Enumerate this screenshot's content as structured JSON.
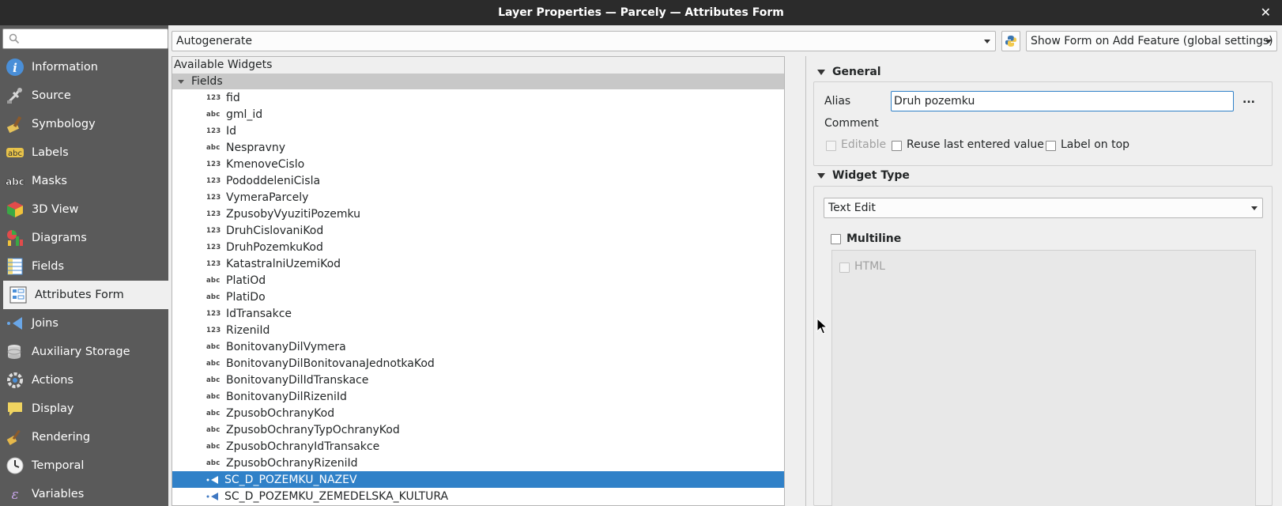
{
  "window": {
    "title": "Layer Properties — Parcely — Attributes Form",
    "close_glyph": "✕"
  },
  "sidebar": {
    "search_placeholder": "",
    "items": [
      {
        "label": "Information",
        "icon": "info-icon"
      },
      {
        "label": "Source",
        "icon": "source-icon"
      },
      {
        "label": "Symbology",
        "icon": "symbology-icon"
      },
      {
        "label": "Labels",
        "icon": "labels-icon"
      },
      {
        "label": "Masks",
        "icon": "masks-icon"
      },
      {
        "label": "3D View",
        "icon": "3d-view-icon"
      },
      {
        "label": "Diagrams",
        "icon": "diagrams-icon"
      },
      {
        "label": "Fields",
        "icon": "fields-icon"
      },
      {
        "label": "Attributes Form",
        "icon": "attributes-form-icon",
        "active": true
      },
      {
        "label": "Joins",
        "icon": "joins-icon"
      },
      {
        "label": "Auxiliary Storage",
        "icon": "auxiliary-storage-icon"
      },
      {
        "label": "Actions",
        "icon": "actions-icon"
      },
      {
        "label": "Display",
        "icon": "display-icon"
      },
      {
        "label": "Rendering",
        "icon": "rendering-icon"
      },
      {
        "label": "Temporal",
        "icon": "temporal-icon"
      },
      {
        "label": "Variables",
        "icon": "variables-icon"
      }
    ]
  },
  "toolbar": {
    "layout_mode": "Autogenerate",
    "python_icon": "python-icon",
    "form_mode": "Show Form on Add Feature (global settings)"
  },
  "widgets": {
    "header": "Available Widgets",
    "root": "Fields",
    "fields": [
      {
        "type": "123",
        "name": "fid"
      },
      {
        "type": "abc",
        "name": "gml_id"
      },
      {
        "type": "123",
        "name": "Id"
      },
      {
        "type": "abc",
        "name": "Nespravny"
      },
      {
        "type": "123",
        "name": "KmenoveCislo"
      },
      {
        "type": "123",
        "name": "PododdeleniCisla"
      },
      {
        "type": "123",
        "name": "VymeraParcely"
      },
      {
        "type": "123",
        "name": "ZpusobyVyuzitiPozemku"
      },
      {
        "type": "123",
        "name": "DruhCislovaniKod"
      },
      {
        "type": "123",
        "name": "DruhPozemkuKod"
      },
      {
        "type": "123",
        "name": "KatastralniUzemiKod"
      },
      {
        "type": "abc",
        "name": "PlatiOd"
      },
      {
        "type": "abc",
        "name": "PlatiDo"
      },
      {
        "type": "123",
        "name": "IdTransakce"
      },
      {
        "type": "123",
        "name": "RizeniId"
      },
      {
        "type": "abc",
        "name": "BonitovanyDilVymera"
      },
      {
        "type": "abc",
        "name": "BonitovanyDilBonitovanaJednotkaKod"
      },
      {
        "type": "abc",
        "name": "BonitovanyDilIdTranskace"
      },
      {
        "type": "abc",
        "name": "BonitovanyDilRizeniId"
      },
      {
        "type": "abc",
        "name": "ZpusobOchranyKod"
      },
      {
        "type": "abc",
        "name": "ZpusobOchranyTypOchranyKod"
      },
      {
        "type": "abc",
        "name": "ZpusobOchranyIdTransakce"
      },
      {
        "type": "abc",
        "name": "ZpusobOchranyRizeniId"
      },
      {
        "type": "join",
        "name": "SC_D_POZEMKU_NAZEV",
        "selected": true
      },
      {
        "type": "join",
        "name": "SC_D_POZEMKU_ZEMEDELSKA_KULTURA"
      }
    ]
  },
  "general": {
    "title": "General",
    "alias_label": "Alias",
    "alias_value": "Druh pozemku",
    "more_button": "...",
    "comment_label": "Comment",
    "editable_label": "Editable",
    "reuse_label": "Reuse last entered value",
    "label_on_top": "Label on top"
  },
  "widget_type": {
    "title": "Widget Type",
    "selected": "Text Edit",
    "multiline_label": "Multiline",
    "html_label": "HTML"
  }
}
